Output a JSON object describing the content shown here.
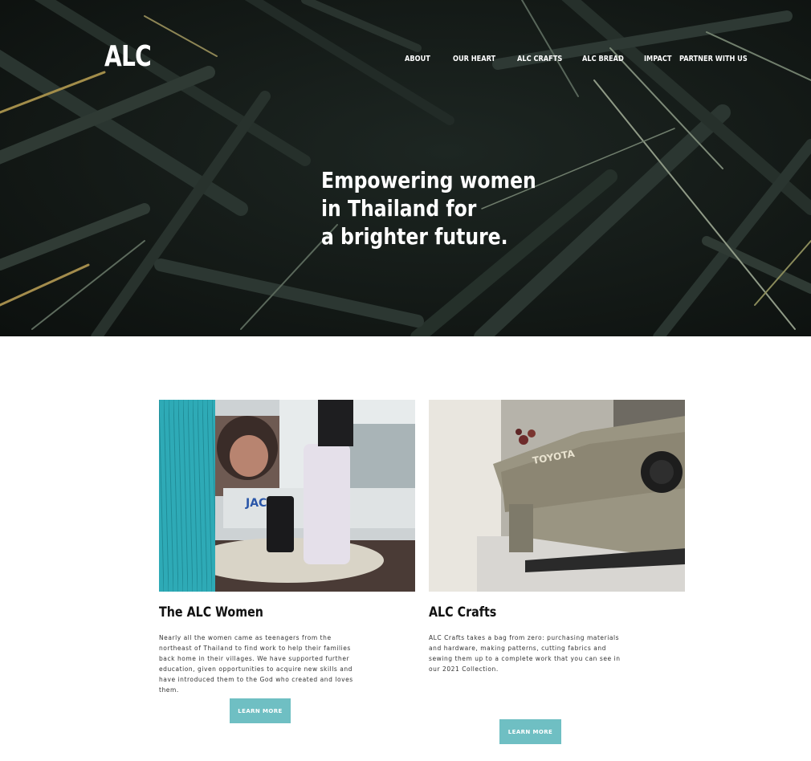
{
  "brand": {
    "logo": "ALC"
  },
  "nav": {
    "items": [
      {
        "label": "ABOUT"
      },
      {
        "label": "OUR HEART"
      },
      {
        "label": "ALC CRAFTS"
      },
      {
        "label": "ALC BREAD"
      },
      {
        "label": "IMPACT"
      },
      {
        "label": "PARTNER WITH US"
      }
    ]
  },
  "hero": {
    "lines": [
      "Empowering women",
      "in Thailand for",
      "a brighter future."
    ]
  },
  "cards": [
    {
      "title": "The ALC Women",
      "text": "Nearly all the women came as teenagers from the northeast of Thailand to find work to help their families back home in their villages. We have supported further education, given opportunities to acquire new skills and have introduced them to the God who created and loves them.",
      "button": "LEARN MORE"
    },
    {
      "title": "ALC Crafts",
      "text": "ALC Crafts takes a bag from zero: purchasing materials and hardware, making patterns, cutting fabrics and sewing them up to a complete work that you can see in our 2021 Collection.",
      "button": "LEARN MORE"
    }
  ],
  "colors": {
    "button": "#6fbfc3",
    "hero_bg": "#141a17",
    "text": "#111111"
  },
  "images": {
    "hero": "dark-palm-leaves-photo",
    "card_1": "thread-spools-sewing-photo",
    "card_2": "sewing-machine-photo"
  }
}
